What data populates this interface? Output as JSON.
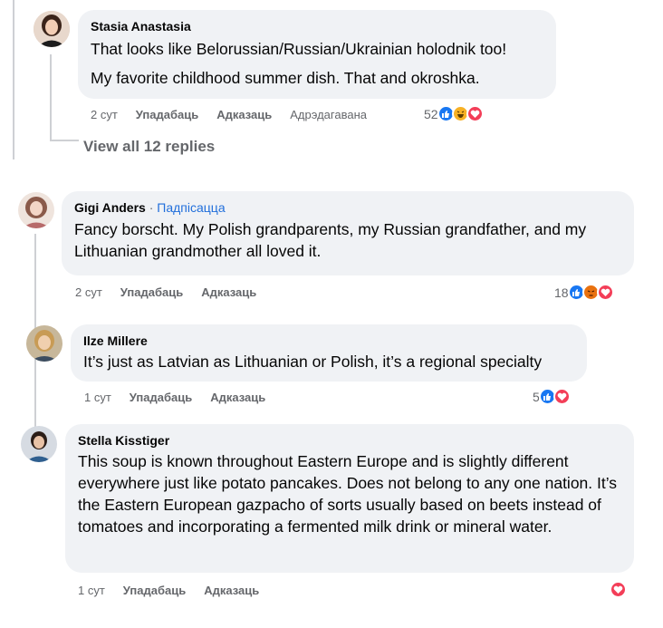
{
  "comments": [
    {
      "author": "Stasia Anastasia",
      "lines": [
        "That looks like Belorussian/Russian/Ukrainian holodnik too!",
        "My favorite childhood summer dish. That and okroshka."
      ],
      "time": "2 сут",
      "like": "Упадабаць",
      "reply": "Адказаць",
      "edited": "Адрэдагавана",
      "reaction_count": "52",
      "reaction_icons": [
        "like-icon",
        "laugh-icon",
        "love-icon"
      ]
    },
    {
      "author": "Gigi Anders",
      "follow": "Падпісацца",
      "lines": [
        "Fancy borscht. My Polish grandparents, my Russian grandfather, and my Lithuanian grandmother all loved it."
      ],
      "time": "2 сут",
      "like": "Упадабаць",
      "reply": "Адказаць",
      "reaction_count": "18",
      "reaction_icons": [
        "like-icon",
        "angry-icon",
        "love-icon"
      ]
    },
    {
      "author": "Ilze Millere",
      "lines": [
        "It’s just as Latvian as Lithuanian or Polish, it’s a regional specialty"
      ],
      "time": "1 сут",
      "like": "Упадабаць",
      "reply": "Адказаць",
      "reaction_count": "5",
      "reaction_icons": [
        "like-icon",
        "love-icon"
      ]
    },
    {
      "author": "Stella Kisstiger",
      "lines": [
        "This soup is known throughout Eastern Europe and is slightly different everywhere just like potato pancakes. Does not belong to any one nation. It’s the Eastern European gazpacho of sorts usually based on beets instead of tomatoes and incorporating a fermented milk drink or mineral water."
      ],
      "time": "1 сут",
      "like": "Упадабаць",
      "reply": "Адказаць",
      "reaction_count": "",
      "reaction_icons": [
        "love-icon"
      ]
    }
  ],
  "view_replies": "View all 12 replies",
  "colors": {
    "bubble": "#f0f2f5",
    "like_blue": "#1877f2",
    "love_red": "#f33e58",
    "haha_yellow": "#f7b125",
    "angry_orange": "#e9710f",
    "follow_blue": "#216fdb",
    "meta_gray": "#65676b"
  }
}
